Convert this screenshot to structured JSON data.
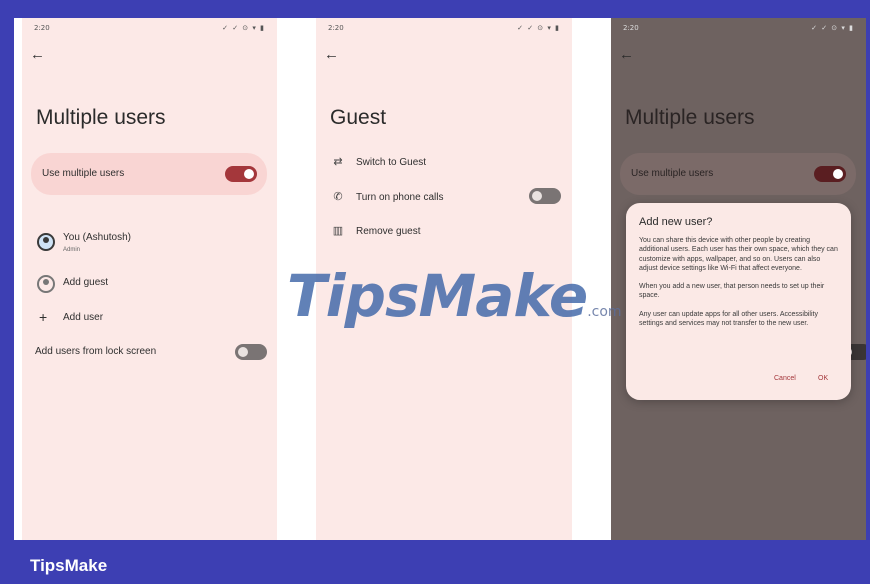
{
  "status_time": "2:20",
  "status_icons": "✓ ✓ ⊙ ▾ ▮",
  "screen1": {
    "title": "Multiple users",
    "use_multiple_users_label": "Use multiple users",
    "user_name": "You (Ashutosh)",
    "user_role": "Admin",
    "add_guest": "Add guest",
    "add_user": "Add user",
    "add_from_lock": "Add users from lock screen"
  },
  "screen2": {
    "title": "Guest",
    "switch_to_guest": "Switch to Guest",
    "phone_calls": "Turn on phone calls",
    "remove_guest": "Remove guest"
  },
  "screen3": {
    "title": "Multiple users",
    "use_multiple_users_label": "Use multiple users",
    "dialog": {
      "title": "Add new user?",
      "p1": "You can share this device with other people by creating additional users. Each user has their own space, which they can customize with apps, wallpaper, and so on. Users can also adjust device settings like Wi-Fi that affect everyone.",
      "p2": "When you add a new user, that person needs to set up their space.",
      "p3": "Any user can update apps for all other users. Accessibility settings and services may not transfer to the new user.",
      "cancel": "Cancel",
      "ok": "OK"
    }
  },
  "watermark": {
    "text": "TipsMake",
    "suffix": ".com"
  },
  "footer_brand": "TipsMake",
  "colors": {
    "accent": "#a4373b",
    "frame": "#3d3fb3",
    "screen_bg": "#fce9e7"
  }
}
